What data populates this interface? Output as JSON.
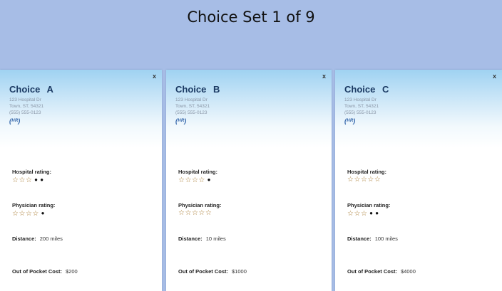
{
  "header": {
    "title": "Choice Set 1 of 9"
  },
  "labels": {
    "hospital_rating": "Hospital rating:",
    "physician_rating": "Physician rating:",
    "distance": "Distance:",
    "cost": "Out of Pocket Cost:",
    "close": "x"
  },
  "choices": [
    {
      "title": "Choice   A",
      "address1": "123 Hospital Dr",
      "address2": "Town, ST, 54321",
      "phone": "(555) 555-0123",
      "logo": "(ᴴᴿ)",
      "hospital_stars": 3,
      "physician_stars": 4,
      "distance": "200 miles",
      "cost": "$200"
    },
    {
      "title": "Choice   B",
      "address1": "123 Hospital Dr",
      "address2": "Town, ST, 54321",
      "phone": "(555) 555-0123",
      "logo": "(ᴴᴿ)",
      "hospital_stars": 4,
      "physician_stars": 5,
      "distance": "10 miles",
      "cost": "$1000"
    },
    {
      "title": "Choice   C",
      "address1": "123 Hospital Dr",
      "address2": "Town, ST, 54321",
      "phone": "(555) 555-0123",
      "logo": "(ᴴᴿ)",
      "hospital_stars": 5,
      "physician_stars": 3,
      "distance": "100 miles",
      "cost": "$4000"
    }
  ],
  "rating_max": 5,
  "colors": {
    "background": "#a7bde6",
    "star": "#a7782d",
    "title": "#1b3a63"
  }
}
